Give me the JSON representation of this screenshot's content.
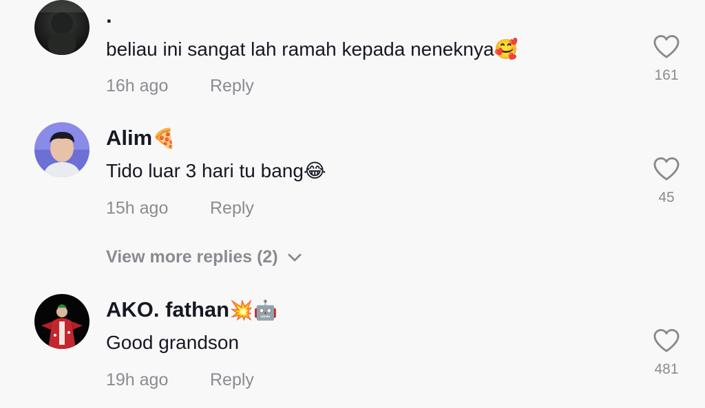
{
  "comments": [
    {
      "username": "·",
      "text": "beliau ini sangat lah ramah kepada neneknya",
      "emoji": "🥰",
      "time": "16h ago",
      "reply_label": "Reply",
      "likes": "161"
    },
    {
      "username": "Alim",
      "username_emoji": "🍕",
      "text": "Tido luar 3 hari tu bang",
      "emoji": "😂",
      "time": "15h ago",
      "reply_label": "Reply",
      "likes": "45"
    },
    {
      "username": "AKO. fathan",
      "username_emoji": "💥🤖",
      "text": "Good grandson",
      "time": "19h ago",
      "reply_label": "Reply",
      "likes": "481"
    }
  ],
  "view_more": {
    "label": "View more replies (2)"
  }
}
